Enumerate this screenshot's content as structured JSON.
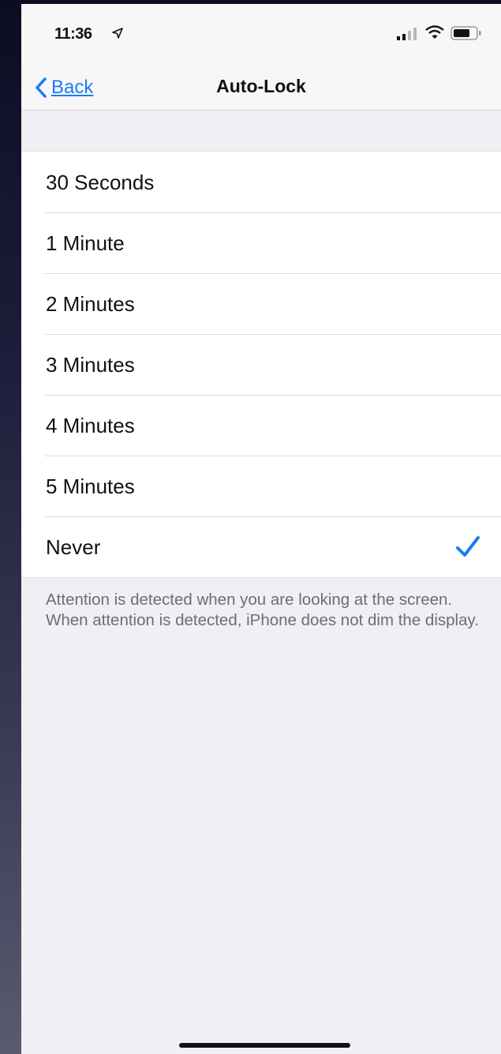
{
  "status_bar": {
    "time": "11:36",
    "icons": [
      "location-arrow-icon",
      "signal-icon",
      "wifi-icon",
      "battery-icon"
    ]
  },
  "nav": {
    "back_label": "Back",
    "title": "Auto-Lock"
  },
  "options": [
    {
      "label": "30 Seconds",
      "selected": false
    },
    {
      "label": "1 Minute",
      "selected": false
    },
    {
      "label": "2 Minutes",
      "selected": false
    },
    {
      "label": "3 Minutes",
      "selected": false
    },
    {
      "label": "4 Minutes",
      "selected": false
    },
    {
      "label": "5 Minutes",
      "selected": false
    },
    {
      "label": "Never",
      "selected": true
    }
  ],
  "footer_note": "Attention is detected when you are looking at the screen. When attention is detected, iPhone does not dim the display.",
  "colors": {
    "accent": "#1a7cf5",
    "background": "#efeff4",
    "cell": "#ffffff"
  }
}
